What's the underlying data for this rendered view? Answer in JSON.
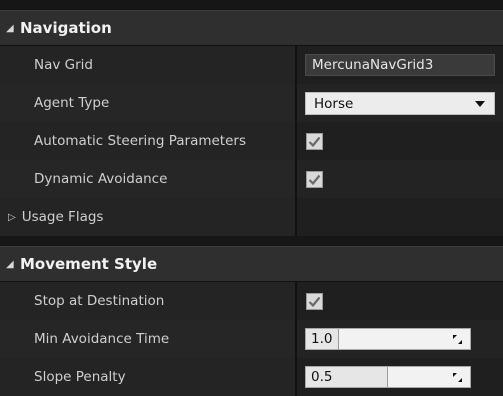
{
  "categories": [
    {
      "label": "Navigation",
      "expanded": true
    },
    {
      "label": "Movement Style",
      "expanded": true
    }
  ],
  "navigation": {
    "nav_grid": {
      "label": "Nav Grid",
      "value": "MercunaNavGrid3"
    },
    "agent_type": {
      "label": "Agent Type",
      "value": "Horse"
    },
    "auto_steering": {
      "label": "Automatic Steering Parameters",
      "checked": true
    },
    "dynamic_avoidance": {
      "label": "Dynamic Avoidance",
      "checked": true
    },
    "usage_flags": {
      "label": "Usage Flags",
      "expanded": false
    }
  },
  "movement_style": {
    "stop_at_destination": {
      "label": "Stop at Destination",
      "checked": true
    },
    "min_avoidance_time": {
      "label": "Min Avoidance Time",
      "value": "1.0",
      "fill_fraction": 0.2
    },
    "slope_penalty": {
      "label": "Slope Penalty",
      "value": "0.5",
      "fill_fraction": 0.5
    }
  },
  "icons": {
    "category_expanded": "triangle-down-icon",
    "category_collapsed": "triangle-right-icon",
    "checkbox_mark": "checkmark-icon",
    "spin_resize": "resize-handle-icon",
    "dropdown_arrow": "chevron-down-icon"
  }
}
